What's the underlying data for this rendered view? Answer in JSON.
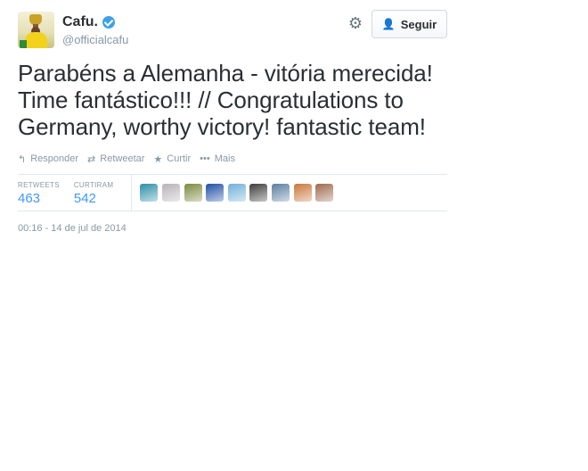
{
  "user": {
    "full_name": "Cafu.",
    "screen_name": "@officialcafu",
    "avatar_icon": "avatar-photo",
    "verified_icon": "verified-badge-icon"
  },
  "header": {
    "gear_icon": "gear-icon",
    "follow_label": "Seguir",
    "follow_icon": "add-user-icon"
  },
  "tweet": {
    "text": "Parabéns a Alemanha - vitória merecida! Time fantástico!!! // Congratulations to Germany, worthy victory! fantastic team!",
    "timestamp": "00:16 - 14 de jul de 2014"
  },
  "actions": [
    {
      "label": "Responder",
      "icon": "reply-icon"
    },
    {
      "label": "Retweetar",
      "icon": "retweet-icon"
    },
    {
      "label": "Curtir",
      "icon": "star-icon"
    },
    {
      "label": "Mais",
      "icon": "more-icon"
    }
  ],
  "stats": {
    "retweets_label": "RETWEETS",
    "retweets_value": "463",
    "likes_label": "CURTIRAM",
    "likes_value": "542"
  },
  "faces": [
    {
      "color": "#2e8fa8"
    },
    {
      "color": "#b9b2b8"
    },
    {
      "color": "#7b8a3d"
    },
    {
      "color": "#1f4fa5"
    },
    {
      "color": "#6fb0d8"
    },
    {
      "color": "#3c3c3c"
    },
    {
      "color": "#5a7fa1"
    },
    {
      "color": "#c9763a"
    },
    {
      "color": "#9d6a4e"
    }
  ],
  "colors": {
    "accent": "#4099ff",
    "muted": "#8899a6",
    "text": "#292f33"
  }
}
